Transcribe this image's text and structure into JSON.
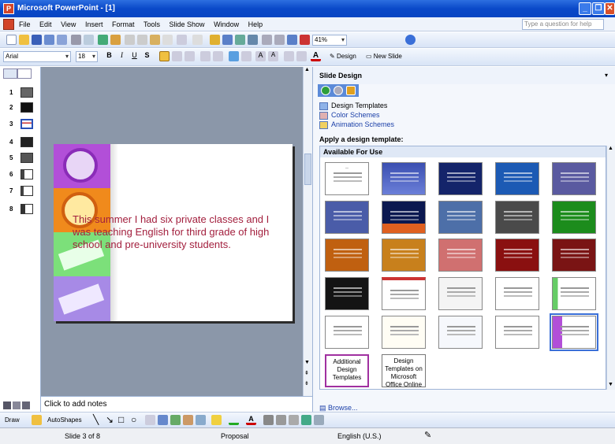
{
  "window": {
    "title": "Microsoft PowerPoint - [1]"
  },
  "menu": {
    "items": [
      "File",
      "Edit",
      "View",
      "Insert",
      "Format",
      "Tools",
      "Slide Show",
      "Window",
      "Help"
    ],
    "help_placeholder": "Type a question for help"
  },
  "toolbar": {
    "zoom": "41%",
    "font": "Arial",
    "font_size": "18",
    "bold": "B",
    "italic": "I",
    "underline": "U",
    "shadow": "S",
    "design_label": "Design",
    "new_slide_label": "New Slide"
  },
  "thumbnails": {
    "numbers": [
      "1",
      "2",
      "3",
      "4",
      "5",
      "6",
      "7",
      "8"
    ],
    "selected": "3"
  },
  "slide": {
    "text": "This summer I had six private classes and I was teaching English for third grade of high school and pre-university students."
  },
  "notes": {
    "placeholder": "Click to add notes"
  },
  "taskpane": {
    "title": "Slide Design",
    "links": [
      "Design Templates",
      "Color Schemes",
      "Animation Schemes"
    ],
    "apply_title": "Apply a design template:",
    "available_header": "Available For Use",
    "additional_label": "Additional Design Templates",
    "online_label": "Design Templates on Microsoft Office Online",
    "browse": "Browse..."
  },
  "drawbar": {
    "draw_label": "Draw",
    "autoshapes_label": "AutoShapes"
  },
  "status": {
    "slide": "Slide 3 of 8",
    "design": "Proposal",
    "language": "English (U.S.)"
  }
}
